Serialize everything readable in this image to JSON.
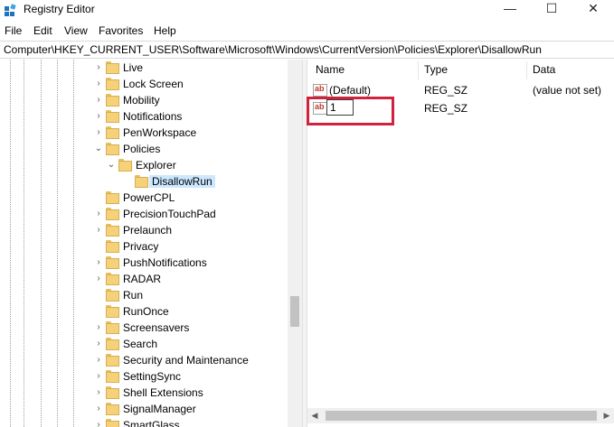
{
  "window": {
    "title": "Registry Editor",
    "icon": "registry-editor-icon",
    "minimize_glyph": "—",
    "maximize_glyph": "☐",
    "close_glyph": "✕"
  },
  "menu": [
    "File",
    "Edit",
    "View",
    "Favorites",
    "Help"
  ],
  "address": "Computer\\HKEY_CURRENT_USER\\Software\\Microsoft\\Windows\\CurrentVersion\\Policies\\Explorer\\DisallowRun",
  "tree": {
    "items": [
      {
        "label": "Live",
        "expander": "›",
        "depth": 0
      },
      {
        "label": "Lock Screen",
        "expander": "›",
        "depth": 0
      },
      {
        "label": "Mobility",
        "expander": "›",
        "depth": 0
      },
      {
        "label": "Notifications",
        "expander": "›",
        "depth": 0
      },
      {
        "label": "PenWorkspace",
        "expander": "›",
        "depth": 0
      },
      {
        "label": "Policies",
        "expander": "⌄",
        "depth": 0
      },
      {
        "label": "Explorer",
        "expander": "⌄",
        "depth": 1
      },
      {
        "label": "DisallowRun",
        "expander": "",
        "depth": 2,
        "selected": true
      },
      {
        "label": "PowerCPL",
        "expander": "",
        "depth": 0
      },
      {
        "label": "PrecisionTouchPad",
        "expander": "›",
        "depth": 0
      },
      {
        "label": "Prelaunch",
        "expander": "›",
        "depth": 0
      },
      {
        "label": "Privacy",
        "expander": "",
        "depth": 0
      },
      {
        "label": "PushNotifications",
        "expander": "›",
        "depth": 0
      },
      {
        "label": "RADAR",
        "expander": "›",
        "depth": 0
      },
      {
        "label": "Run",
        "expander": "",
        "depth": 0
      },
      {
        "label": "RunOnce",
        "expander": "",
        "depth": 0
      },
      {
        "label": "Screensavers",
        "expander": "›",
        "depth": 0
      },
      {
        "label": "Search",
        "expander": "›",
        "depth": 0
      },
      {
        "label": "Security and Maintenance",
        "expander": "›",
        "depth": 0
      },
      {
        "label": "SettingSync",
        "expander": "›",
        "depth": 0
      },
      {
        "label": "Shell Extensions",
        "expander": "›",
        "depth": 0
      },
      {
        "label": "SignalManager",
        "expander": "›",
        "depth": 0
      },
      {
        "label": "SmartGlass",
        "expander": "›",
        "depth": 0
      }
    ]
  },
  "values": {
    "columns": {
      "name": "Name",
      "type": "Type",
      "data": "Data"
    },
    "rows": [
      {
        "name": "(Default)",
        "type": "REG_SZ",
        "data": "(value not set)",
        "icon": "string-value-icon"
      },
      {
        "name": "1",
        "type": "REG_SZ",
        "data": "",
        "icon": "string-value-icon",
        "editing": true
      }
    ]
  },
  "colors": {
    "highlight_box": "#d0223c",
    "selection": "#cce8ff",
    "folder": "#f5d27a"
  }
}
